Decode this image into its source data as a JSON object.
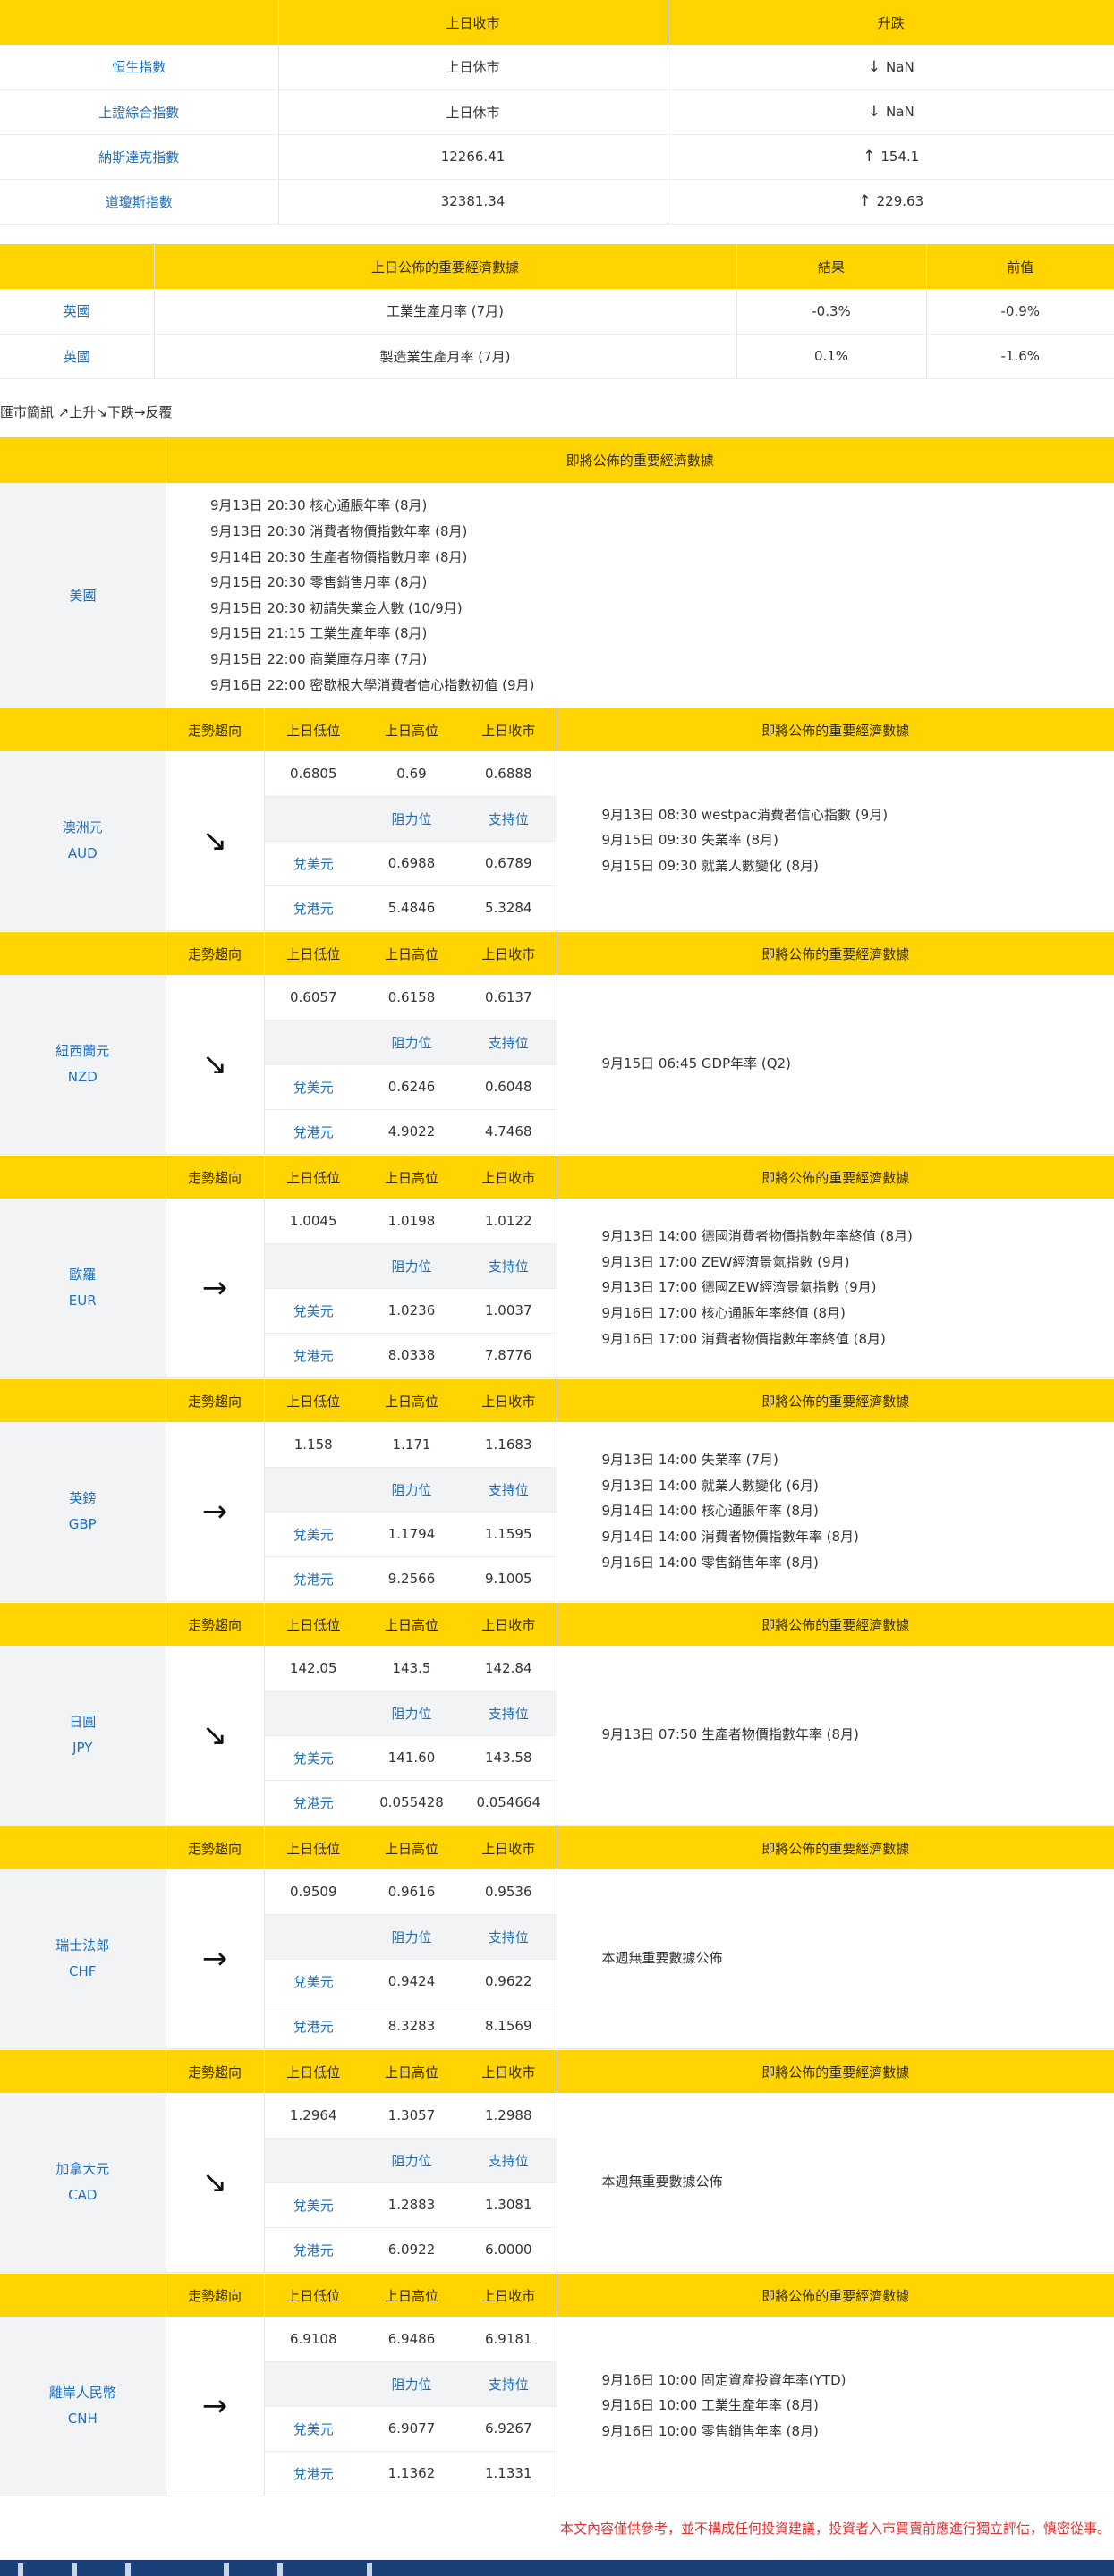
{
  "index_table": {
    "headers": [
      "",
      "上日收市",
      "升跌"
    ],
    "rows": [
      {
        "name": "恒生指數",
        "close": "上日休市",
        "arrow": "↓",
        "change": "NaN"
      },
      {
        "name": "上證綜合指數",
        "close": "上日休市",
        "arrow": "↓",
        "change": "NaN"
      },
      {
        "name": "納斯達克指數",
        "close": "12266.41",
        "arrow": "↑",
        "change": "154.1"
      },
      {
        "name": "道瓊斯指數",
        "close": "32381.34",
        "arrow": "↑",
        "change": "229.63"
      }
    ]
  },
  "econ_table": {
    "headers": [
      "",
      "上日公佈的重要經濟數據",
      "結果",
      "前值"
    ],
    "rows": [
      {
        "country": "英國",
        "item": "工業生產月率 (7月)",
        "result": "-0.3%",
        "prev": "-0.9%"
      },
      {
        "country": "英國",
        "item": "製造業生產月率 (7月)",
        "result": "0.1%",
        "prev": "-1.6%"
      }
    ]
  },
  "legend": "匯市簡訊 ↗上升↘下跌→反覆",
  "us_table": {
    "header": "即將公佈的重要經濟數據",
    "country": "美國",
    "events": [
      "9月13日 20:30 核心通脹年率 (8月)",
      "9月13日 20:30 消費者物價指數年率 (8月)",
      "9月14日 20:30 生產者物價指數月率 (8月)",
      "9月15日 20:30 零售銷售月率 (8月)",
      "9月15日 20:30 初請失業金人數 (10/9月)",
      "9月15日 21:15 工業生產年率 (8月)",
      "9月15日 22:00 商業庫存月率 (7月)",
      "9月16日 22:00 密歇根大學消費者信心指數初值 (9月)"
    ]
  },
  "ccy_headers": {
    "trend": "走勢趨向",
    "low": "上日低位",
    "high": "上日高位",
    "close": "上日收市",
    "upcoming": "即將公佈的重要經濟數據",
    "resistance": "阻力位",
    "support": "支持位",
    "vs_usd": "兌美元",
    "vs_hkd": "兌港元"
  },
  "currencies": [
    {
      "name": "澳洲元",
      "code": "AUD",
      "trend": "↘",
      "low": "0.6805",
      "high": "0.69",
      "close": "0.6888",
      "usd_res": "0.6988",
      "usd_sup": "0.6789",
      "hkd_res": "5.4846",
      "hkd_sup": "5.3284",
      "events": [
        "9月13日 08:30 westpac消費者信心指數 (9月)",
        "9月15日 09:30 失業率 (8月)",
        "9月15日 09:30 就業人數變化 (8月)"
      ]
    },
    {
      "name": "紐西蘭元",
      "code": "NZD",
      "trend": "↘",
      "low": "0.6057",
      "high": "0.6158",
      "close": "0.6137",
      "usd_res": "0.6246",
      "usd_sup": "0.6048",
      "hkd_res": "4.9022",
      "hkd_sup": "4.7468",
      "events": [
        "9月15日 06:45 GDP年率 (Q2)"
      ]
    },
    {
      "name": "歐羅",
      "code": "EUR",
      "trend": "→",
      "low": "1.0045",
      "high": "1.0198",
      "close": "1.0122",
      "usd_res": "1.0236",
      "usd_sup": "1.0037",
      "hkd_res": "8.0338",
      "hkd_sup": "7.8776",
      "events": [
        "9月13日 14:00 德國消費者物價指數年率終值 (8月)",
        "9月13日 17:00 ZEW經濟景氣指數 (9月)",
        "9月13日 17:00 德國ZEW經濟景氣指數 (9月)",
        "9月16日 17:00 核心通脹年率終值 (8月)",
        "9月16日 17:00 消費者物價指數年率終值 (8月)"
      ]
    },
    {
      "name": "英鎊",
      "code": "GBP",
      "trend": "→",
      "low": "1.158",
      "high": "1.171",
      "close": "1.1683",
      "usd_res": "1.1794",
      "usd_sup": "1.1595",
      "hkd_res": "9.2566",
      "hkd_sup": "9.1005",
      "events": [
        "9月13日 14:00 失業率 (7月)",
        "9月13日 14:00 就業人數變化 (6月)",
        "9月14日 14:00 核心通脹年率 (8月)",
        "9月14日 14:00 消費者物價指數年率 (8月)",
        "9月16日 14:00 零售銷售年率 (8月)"
      ]
    },
    {
      "name": "日圓",
      "code": "JPY",
      "trend": "↘",
      "low": "142.05",
      "high": "143.5",
      "close": "142.84",
      "usd_res": "141.60",
      "usd_sup": "143.58",
      "hkd_res": "0.055428",
      "hkd_sup": "0.054664",
      "events": [
        "9月13日 07:50 生產者物價指數年率 (8月)"
      ]
    },
    {
      "name": "瑞士法郎",
      "code": "CHF",
      "trend": "→",
      "low": "0.9509",
      "high": "0.9616",
      "close": "0.9536",
      "usd_res": "0.9424",
      "usd_sup": "0.9622",
      "hkd_res": "8.3283",
      "hkd_sup": "8.1569",
      "events": [
        "本週無重要數據公佈"
      ]
    },
    {
      "name": "加拿大元",
      "code": "CAD",
      "trend": "↘",
      "low": "1.2964",
      "high": "1.3057",
      "close": "1.2988",
      "usd_res": "1.2883",
      "usd_sup": "1.3081",
      "hkd_res": "6.0922",
      "hkd_sup": "6.0000",
      "events": [
        "本週無重要數據公佈"
      ]
    },
    {
      "name": "離岸人民幣",
      "code": "CNH",
      "trend": "→",
      "low": "6.9108",
      "high": "6.9486",
      "close": "6.9181",
      "usd_res": "6.9077",
      "usd_sup": "6.9267",
      "hkd_res": "1.1362",
      "hkd_sup": "1.1331",
      "events": [
        "9月16日 10:00 固定資產投資年率(YTD)",
        "9月16日 10:00 工業生產年率 (8月)",
        "9月16日 10:00 零售銷售年率 (8月)"
      ]
    }
  ],
  "disclaimer": "本文內容僅供參考，並不構成任何投資建議，投資者入市買賣前應進行獨立評估，慎密從事。"
}
